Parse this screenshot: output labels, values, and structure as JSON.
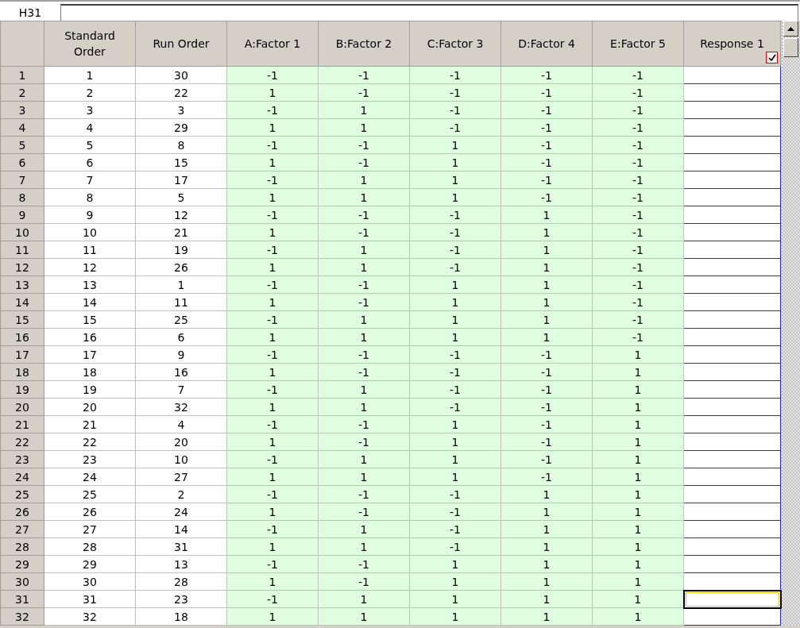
{
  "name_box": "H31",
  "columns": [
    {
      "kind": "rowhead"
    },
    {
      "kind": "index",
      "label": "Standard Order"
    },
    {
      "kind": "index",
      "label": "Run Order"
    },
    {
      "kind": "factor",
      "label": "A:Factor 1"
    },
    {
      "kind": "factor",
      "label": "B:Factor 2"
    },
    {
      "kind": "factor",
      "label": "C:Factor 3"
    },
    {
      "kind": "factor",
      "label": "D:Factor 4"
    },
    {
      "kind": "factor",
      "label": "E:Factor 5"
    },
    {
      "kind": "response",
      "label": "Response 1",
      "checked": true
    }
  ],
  "rows": [
    {
      "row": "1",
      "cells": [
        "1",
        "30",
        "-1",
        "-1",
        "-1",
        "-1",
        "-1"
      ],
      "selected": false
    },
    {
      "row": "2",
      "cells": [
        "2",
        "22",
        "1",
        "-1",
        "-1",
        "-1",
        "-1"
      ],
      "selected": false
    },
    {
      "row": "3",
      "cells": [
        "3",
        "3",
        "-1",
        "1",
        "-1",
        "-1",
        "-1"
      ],
      "selected": false
    },
    {
      "row": "4",
      "cells": [
        "4",
        "29",
        "1",
        "1",
        "-1",
        "-1",
        "-1"
      ],
      "selected": false
    },
    {
      "row": "5",
      "cells": [
        "5",
        "8",
        "-1",
        "-1",
        "1",
        "-1",
        "-1"
      ],
      "selected": false
    },
    {
      "row": "6",
      "cells": [
        "6",
        "15",
        "1",
        "-1",
        "1",
        "-1",
        "-1"
      ],
      "selected": false
    },
    {
      "row": "7",
      "cells": [
        "7",
        "17",
        "-1",
        "1",
        "1",
        "-1",
        "-1"
      ],
      "selected": false
    },
    {
      "row": "8",
      "cells": [
        "8",
        "5",
        "1",
        "1",
        "1",
        "-1",
        "-1"
      ],
      "selected": false
    },
    {
      "row": "9",
      "cells": [
        "9",
        "12",
        "-1",
        "-1",
        "-1",
        "1",
        "-1"
      ],
      "selected": false
    },
    {
      "row": "10",
      "cells": [
        "10",
        "21",
        "1",
        "-1",
        "-1",
        "1",
        "-1"
      ],
      "selected": false
    },
    {
      "row": "11",
      "cells": [
        "11",
        "19",
        "-1",
        "1",
        "-1",
        "1",
        "-1"
      ],
      "selected": false
    },
    {
      "row": "12",
      "cells": [
        "12",
        "26",
        "1",
        "1",
        "-1",
        "1",
        "-1"
      ],
      "selected": false
    },
    {
      "row": "13",
      "cells": [
        "13",
        "1",
        "-1",
        "-1",
        "1",
        "1",
        "-1"
      ],
      "selected": false
    },
    {
      "row": "14",
      "cells": [
        "14",
        "11",
        "1",
        "-1",
        "1",
        "1",
        "-1"
      ],
      "selected": false
    },
    {
      "row": "15",
      "cells": [
        "15",
        "25",
        "-1",
        "1",
        "1",
        "1",
        "-1"
      ],
      "selected": false
    },
    {
      "row": "16",
      "cells": [
        "16",
        "6",
        "1",
        "1",
        "1",
        "1",
        "-1"
      ],
      "selected": false
    },
    {
      "row": "17",
      "cells": [
        "17",
        "9",
        "-1",
        "-1",
        "-1",
        "-1",
        "1"
      ],
      "selected": false
    },
    {
      "row": "18",
      "cells": [
        "18",
        "16",
        "1",
        "-1",
        "-1",
        "-1",
        "1"
      ],
      "selected": false
    },
    {
      "row": "19",
      "cells": [
        "19",
        "7",
        "-1",
        "1",
        "-1",
        "-1",
        "1"
      ],
      "selected": false
    },
    {
      "row": "20",
      "cells": [
        "20",
        "32",
        "1",
        "1",
        "-1",
        "-1",
        "1"
      ],
      "selected": false
    },
    {
      "row": "21",
      "cells": [
        "21",
        "4",
        "-1",
        "-1",
        "1",
        "-1",
        "1"
      ],
      "selected": false
    },
    {
      "row": "22",
      "cells": [
        "22",
        "20",
        "1",
        "-1",
        "1",
        "-1",
        "1"
      ],
      "selected": false
    },
    {
      "row": "23",
      "cells": [
        "23",
        "10",
        "-1",
        "1",
        "1",
        "-1",
        "1"
      ],
      "selected": false
    },
    {
      "row": "24",
      "cells": [
        "24",
        "27",
        "1",
        "1",
        "1",
        "-1",
        "1"
      ],
      "selected": false
    },
    {
      "row": "25",
      "cells": [
        "25",
        "2",
        "-1",
        "-1",
        "-1",
        "1",
        "1"
      ],
      "selected": false
    },
    {
      "row": "26",
      "cells": [
        "26",
        "24",
        "1",
        "-1",
        "-1",
        "1",
        "1"
      ],
      "selected": false
    },
    {
      "row": "27",
      "cells": [
        "27",
        "14",
        "-1",
        "1",
        "-1",
        "1",
        "1"
      ],
      "selected": false
    },
    {
      "row": "28",
      "cells": [
        "28",
        "31",
        "1",
        "1",
        "-1",
        "1",
        "1"
      ],
      "selected": false
    },
    {
      "row": "29",
      "cells": [
        "29",
        "13",
        "-1",
        "-1",
        "1",
        "1",
        "1"
      ],
      "selected": false
    },
    {
      "row": "30",
      "cells": [
        "30",
        "28",
        "1",
        "-1",
        "1",
        "1",
        "1"
      ],
      "selected": false
    },
    {
      "row": "31",
      "cells": [
        "31",
        "23",
        "-1",
        "1",
        "1",
        "1",
        "1"
      ],
      "selected": true
    },
    {
      "row": "32",
      "cells": [
        "32",
        "18",
        "1",
        "1",
        "1",
        "1",
        "1"
      ],
      "selected": false
    }
  ]
}
